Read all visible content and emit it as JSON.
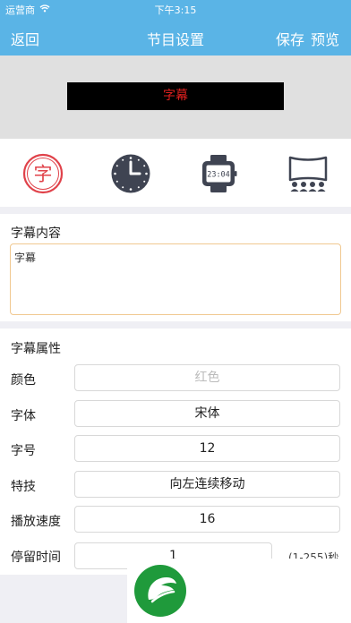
{
  "status_bar": {
    "carrier": "运营商",
    "time": "下午3:15",
    "wifi_icon": "wifi-icon"
  },
  "nav": {
    "back_label": "返回",
    "title": "节目设置",
    "save_label": "保存",
    "preview_label": "预览"
  },
  "preview": {
    "led_text": "字幕"
  },
  "modes": [
    {
      "name": "subtitle-mode",
      "icon": "subtitle-char-icon",
      "glyph": "字"
    },
    {
      "name": "clock-mode",
      "icon": "analog-clock-icon"
    },
    {
      "name": "digital-clock-mode",
      "icon": "digital-watch-icon",
      "glyph": "23:04"
    },
    {
      "name": "cinema-mode",
      "icon": "screen-audience-icon"
    }
  ],
  "content": {
    "title": "字幕内容",
    "value": "字幕"
  },
  "attributes": {
    "title": "字幕属性",
    "color_label": "颜色",
    "color_value": "红色",
    "font_label": "字体",
    "font_value": "宋体",
    "size_label": "字号",
    "size_value": "12",
    "effect_label": "特技",
    "effect_value": "向左连续移动",
    "speed_label": "播放速度",
    "speed_value": "16",
    "stay_label": "停留时间",
    "stay_value": "1",
    "stay_unit": "(1-255)秒"
  },
  "colors": {
    "accent": "#5ab4e6",
    "led_text": "#e0201e",
    "mode_red": "#e0424a",
    "mode_dark": "#3f4452",
    "logo_green": "#1f9a3b"
  }
}
